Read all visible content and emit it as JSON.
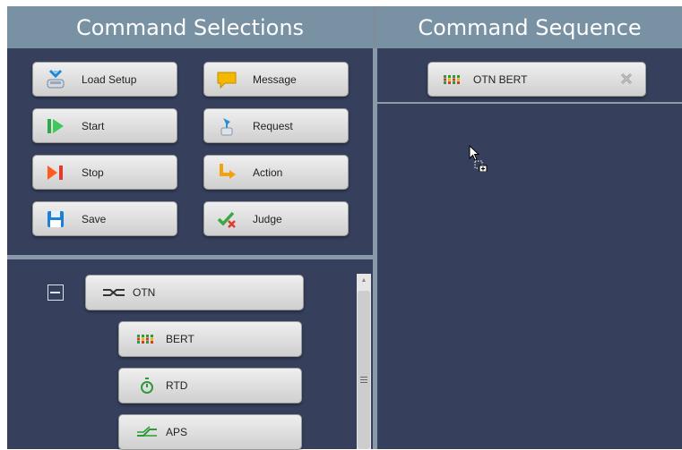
{
  "panels": {
    "selections_title": "Command Selections",
    "sequence_title": "Command Sequence"
  },
  "commands": {
    "load_setup": "Load Setup",
    "message": "Message",
    "start": "Start",
    "request": "Request",
    "stop": "Stop",
    "action": "Action",
    "save": "Save",
    "judge": "Judge"
  },
  "tree": {
    "root": "OTN",
    "children": [
      "BERT",
      "RTD",
      "APS"
    ]
  },
  "sequence": {
    "items": [
      "OTN BERT"
    ]
  },
  "icons": {
    "load_setup": "load-setup-icon",
    "message": "speech-bubble-icon",
    "start": "play-icon",
    "request": "request-icon",
    "stop": "stop-icon",
    "action": "arrow-turn-icon",
    "save": "floppy-disk-icon",
    "judge": "check-x-icon",
    "otn": "otn-signal-icon",
    "bert": "bert-grid-icon",
    "rtd": "stopwatch-icon",
    "aps": "aps-switch-icon",
    "remove": "close-icon",
    "collapse": "collapse-icon",
    "cursor": "drag-copy-cursor-icon"
  },
  "colors": {
    "header_bg": "#7891a3",
    "panel_bg": "#36405d",
    "splitter": "#8899a7",
    "button_top": "#efefef",
    "button_bottom": "#cfcfcf"
  }
}
